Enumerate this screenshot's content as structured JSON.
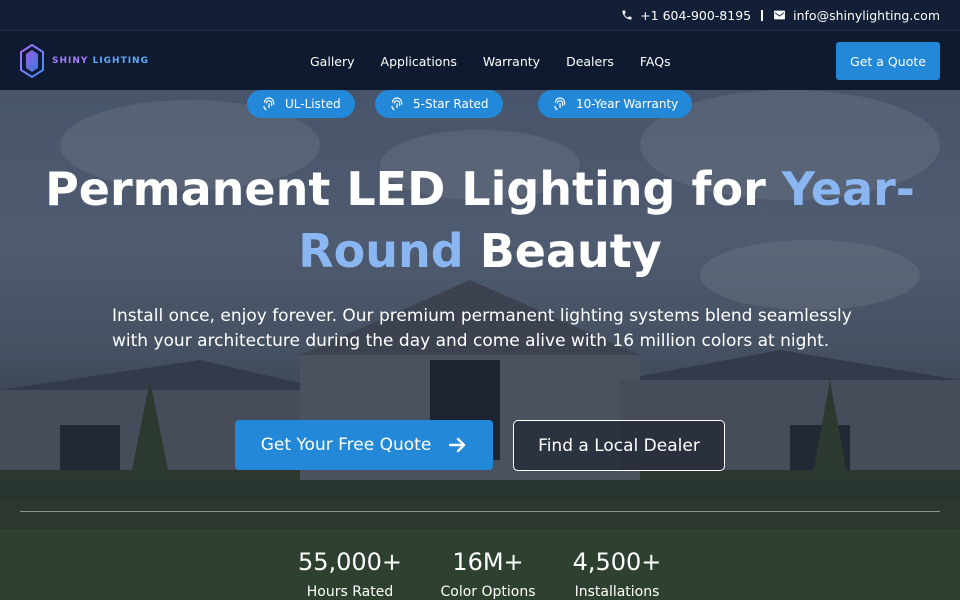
{
  "topbar": {
    "phone": "+1 604-900-8195",
    "email": "info@shinylighting.com"
  },
  "brand": {
    "word1": "SHINY",
    "word2": "LIGHTING"
  },
  "nav": {
    "items": [
      "Gallery",
      "Applications",
      "Warranty",
      "Dealers",
      "FAQs"
    ],
    "cta": "Get a Quote"
  },
  "badges": [
    "UL-Listed",
    "5-Star Rated",
    "10-Year Warranty"
  ],
  "hero": {
    "headline_1": "Permanent LED Lighting for ",
    "headline_highlight_1": "Year-",
    "headline_highlight_2": "Round",
    "headline_2": " Beauty",
    "subtext": "Install once, enjoy forever. Our premium permanent lighting systems blend seamlessly with your architecture during the day and come alive with 16 million colors at night.",
    "primary_cta": "Get Your Free Quote",
    "secondary_cta": "Find a Local Dealer"
  },
  "stats": [
    {
      "value": "55,000+",
      "label": "Hours Rated"
    },
    {
      "value": "16M+",
      "label": "Color Options"
    },
    {
      "value": "4,500+",
      "label": "Installations"
    }
  ],
  "colors": {
    "accent": "#2388d8",
    "highlight": "#8ab6f2",
    "nav_bg": "#0e1a30"
  }
}
